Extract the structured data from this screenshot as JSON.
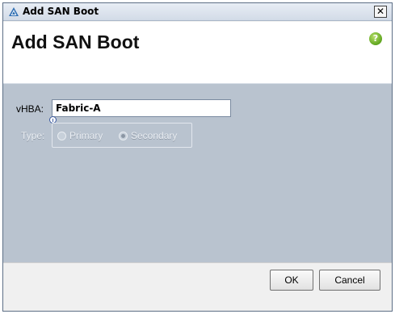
{
  "window": {
    "title": "Add SAN Boot",
    "close_label": "✕"
  },
  "header": {
    "title": "Add SAN Boot",
    "help_label": "?"
  },
  "form": {
    "vhba_label": "vHBA:",
    "vhba_value": "Fabric-A",
    "type_label": "Type:",
    "type_options": [
      {
        "label": "Primary",
        "selected": false
      },
      {
        "label": "Secondary",
        "selected": true
      }
    ]
  },
  "footer": {
    "ok_label": "OK",
    "cancel_label": "Cancel"
  },
  "colors": {
    "content_bg": "#b9c3cf",
    "help_green": "#5fa51f"
  }
}
